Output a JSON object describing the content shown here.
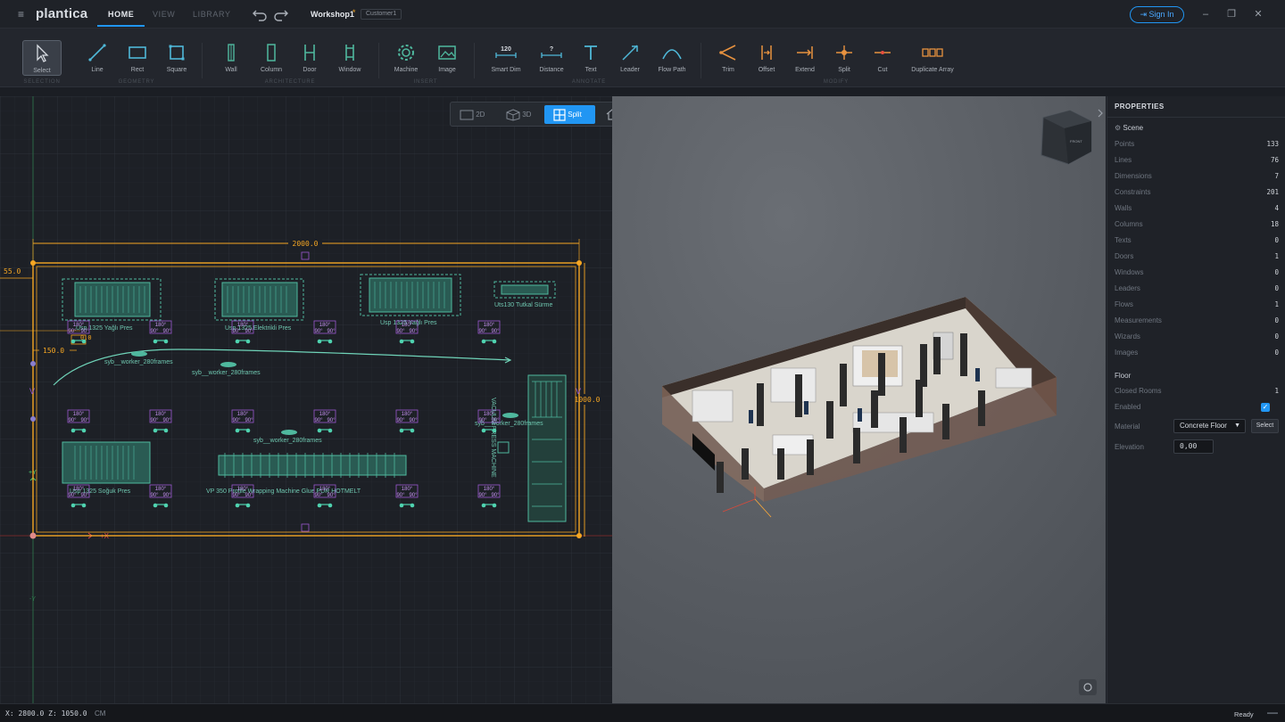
{
  "app": {
    "logo": "plantica",
    "tabs": [
      "HOME",
      "VIEW",
      "LIBRARY"
    ],
    "document": "Workshop1",
    "unsaved_marker": "*",
    "customer": "Customer1",
    "sign_in": "Sign In"
  },
  "toolbar": {
    "groups": {
      "selection": "SELECTION",
      "geometry": "GEOMETRY",
      "architecture": "ARCHITECTURE",
      "insert": "INSERT",
      "annotate": "ANNOTATE",
      "modify": "MODIFY"
    },
    "tools": {
      "select": "Select",
      "line": "Line",
      "rect": "Rect",
      "square": "Square",
      "wall": "Wall",
      "column": "Column",
      "door": "Door",
      "window": "Window",
      "machine": "Machine",
      "image": "Image",
      "smart_dim": "Smart Dim",
      "smart_dim_value": "120",
      "distance": "Distance",
      "distance_value": "?",
      "text": "Text",
      "leader": "Leader",
      "flow_path": "Flow Path",
      "trim": "Trim",
      "offset": "Offset",
      "extend": "Extend",
      "split": "Split",
      "cut": "Cut",
      "duplicate_array": "Duplicate Array"
    }
  },
  "view_switch": {
    "two_d": "2D",
    "three_d": "3D",
    "split": "Split",
    "active": "Split"
  },
  "plan": {
    "dims": {
      "width": "2000.0",
      "height": "1000.0",
      "offset_top": "55.0",
      "offset_left": "150.0",
      "small": "0.0"
    },
    "axis_x": "+X",
    "axis_y": "+Y",
    "axis_neg_y": "-Y",
    "machine_labels": [
      "Usp 1325 Yağlı Pres",
      "Usp 1325 Elektrikli Pres",
      "Usp 1325 Yağlı Pres",
      "Uts130 Tutkal Sürme",
      "Usp 1325 Soğuk Pres",
      "VP 350 Profile Wrapping Machine Glue PUR HOTMELT",
      "VACUUM PRESS MACHINE"
    ],
    "worker_labels": [
      "syb__worker_280frames",
      "syb__worker_280frames",
      "syb__worker_280frames",
      "syb__worker_280frames"
    ],
    "rot_angle_top": "180°",
    "rot_angle_side": "90°"
  },
  "properties": {
    "title": "PROPERTIES",
    "scene_label": "Scene",
    "scene_rows": [
      {
        "k": "Points",
        "v": "133"
      },
      {
        "k": "Lines",
        "v": "76"
      },
      {
        "k": "Dimensions",
        "v": "7"
      },
      {
        "k": "Constraints",
        "v": "201"
      },
      {
        "k": "Walls",
        "v": "4"
      },
      {
        "k": "Columns",
        "v": "18"
      },
      {
        "k": "Texts",
        "v": "0"
      },
      {
        "k": "Doors",
        "v": "1"
      },
      {
        "k": "Windows",
        "v": "0"
      },
      {
        "k": "Leaders",
        "v": "0"
      },
      {
        "k": "Flows",
        "v": "1"
      },
      {
        "k": "Measurements",
        "v": "0"
      },
      {
        "k": "Wizards",
        "v": "0"
      },
      {
        "k": "Images",
        "v": "0"
      }
    ],
    "floor_label": "Floor",
    "closed_rooms_label": "Closed Rooms",
    "closed_rooms": "1",
    "enabled_label": "Enabled",
    "enabled": true,
    "material_label": "Material",
    "material": "Concrete Floor",
    "material_button": "Select",
    "elevation_label": "Elevation",
    "elevation": "0,00"
  },
  "viewcube_label": "FRONT",
  "status": {
    "coords": "X: 2800.0  Z: 1050.0",
    "unit": "CM",
    "ready": "Ready"
  },
  "colors": {
    "accent": "#2196f3",
    "machine": "#4fb89e",
    "dimension": "#f5a623",
    "marker": "#9b59d0"
  }
}
